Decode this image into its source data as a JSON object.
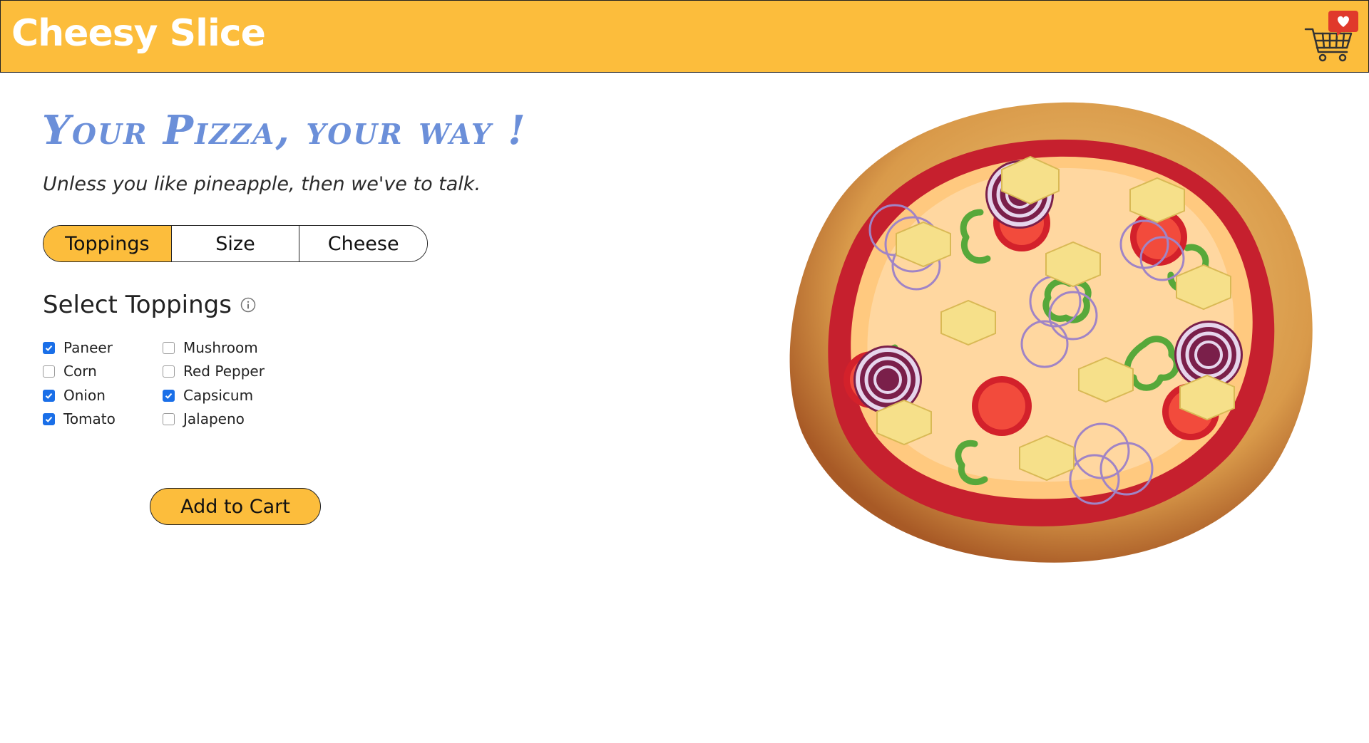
{
  "header": {
    "brand": "Cheesy Slice",
    "cart_icon": "cart-with-heart-icon",
    "brand_color": "#fcbd3c"
  },
  "hero": {
    "title": "Your Pizza, your way !",
    "subtitle": "Unless you like pineapple, then we've to talk."
  },
  "tabs": [
    {
      "label": "Toppings",
      "active": true
    },
    {
      "label": "Size",
      "active": false
    },
    {
      "label": "Cheese",
      "active": false
    }
  ],
  "toppings": {
    "title": "Select Toppings",
    "info_icon": "info-circle-icon",
    "options": [
      {
        "label": "Paneer",
        "checked": true
      },
      {
        "label": "Corn",
        "checked": false
      },
      {
        "label": "Onion",
        "checked": true
      },
      {
        "label": "Tomato",
        "checked": true
      },
      {
        "label": "Mushroom",
        "checked": false
      },
      {
        "label": "Red Pepper",
        "checked": false
      },
      {
        "label": "Capsicum",
        "checked": true
      },
      {
        "label": "Jalapeno",
        "checked": false
      }
    ]
  },
  "actions": {
    "add_to_cart": "Add to Cart"
  }
}
